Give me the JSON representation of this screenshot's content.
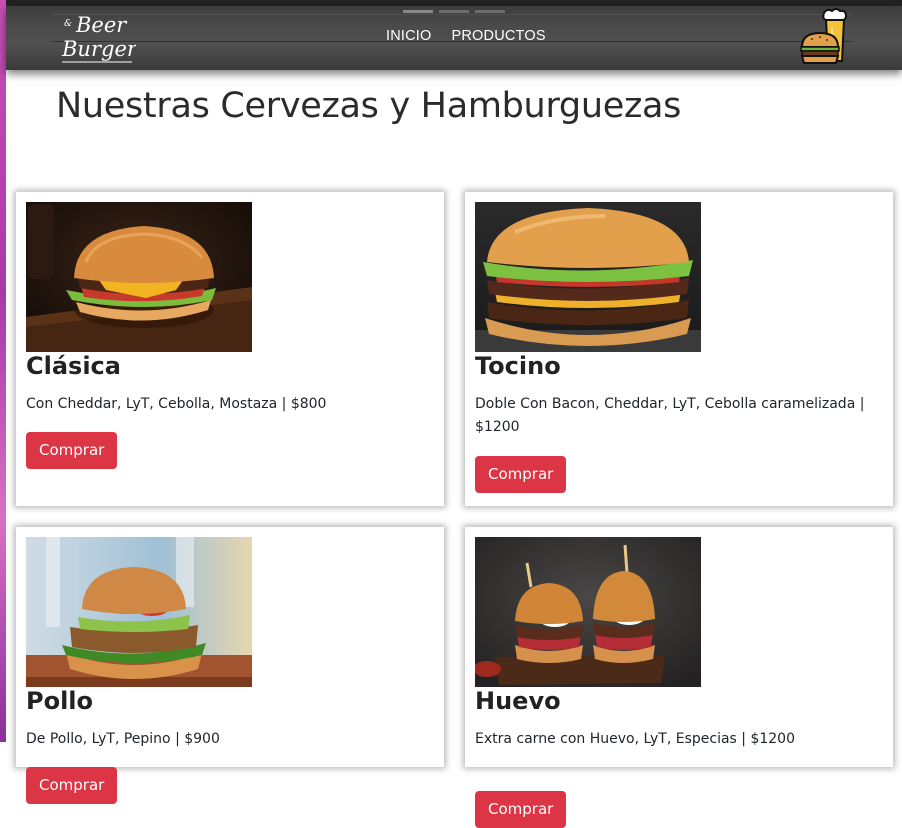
{
  "nav": {
    "logo_text_top": "Beer",
    "logo_text_bottom": "Burger",
    "logo_amp": "&",
    "links": [
      "INICIO",
      "PRODUCTOS"
    ],
    "cart_icon": "burger-beer-icon"
  },
  "page": {
    "title": "Nuestras Cervezas y Hamburguezas"
  },
  "products": [
    {
      "name": "Clásica",
      "description": "Con Cheddar, LyT, Cebolla, Mostaza | $800",
      "button": "Comprar"
    },
    {
      "name": "Tocino",
      "description": "Doble Con Bacon, Cheddar, LyT, Cebolla caramelizada | $1200",
      "button": "Comprar"
    },
    {
      "name": "Pollo",
      "description": "De Pollo, LyT, Pepino | $900",
      "button": "Comprar"
    },
    {
      "name": "Huevo",
      "description": "Extra carne con Huevo, LyT, Especias | $1200",
      "button": "Comprar"
    }
  ],
  "colors": {
    "button": "#dc3545",
    "navbar": "#454545",
    "text": "#212529"
  }
}
